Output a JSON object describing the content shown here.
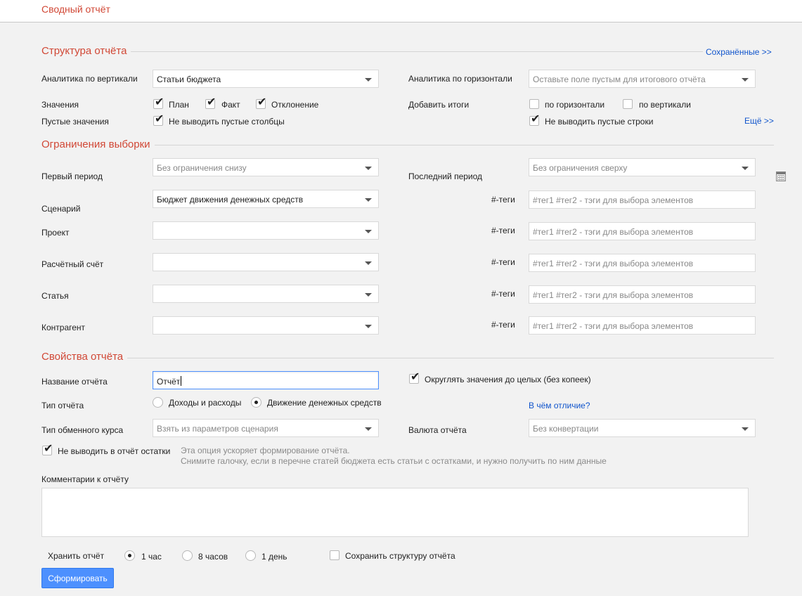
{
  "app": {
    "title": "Сводный отчёт"
  },
  "structure": {
    "title": "Структура отчёта",
    "saved_link": "Сохранённые >>",
    "more_link": "Ещё >>",
    "vertical": {
      "label": "Аналитика по вертикали",
      "value": "Статьи бюджета"
    },
    "horizontal": {
      "label": "Аналитика по горизонтали",
      "placeholder": "Оставьте поле пустым для итогового отчёта"
    },
    "values": {
      "label": "Значения",
      "plan": "План",
      "fact": "Факт",
      "deviation": "Отклонение"
    },
    "totals": {
      "label": "Добавить итоги",
      "horizontal": "по горизонтали",
      "vertical": "по вертикали"
    },
    "empty": {
      "label": "Пустые значения",
      "no_columns": "Не выводить пустые столбцы",
      "no_rows": "Не выводить пустые строки"
    }
  },
  "filters": {
    "title": "Ограничения выборки",
    "first_period": {
      "label": "Первый период",
      "placeholder": "Без ограничения снизу"
    },
    "last_period": {
      "label": "Последний период",
      "placeholder": "Без ограничения сверху"
    },
    "scenario": {
      "label": "Сценарий",
      "value": "Бюджет движения денежных средств"
    },
    "project": {
      "label": "Проект"
    },
    "account": {
      "label": "Расчётный счёт"
    },
    "article": {
      "label": "Статья"
    },
    "contractor": {
      "label": "Контрагент"
    },
    "tags_label": "#-теги",
    "tags_placeholder": "#тег1 #тег2 - тэги для выбора элементов"
  },
  "properties": {
    "title": "Свойства отчёта",
    "name": {
      "label": "Название отчёта",
      "value": "Отчёт"
    },
    "round": "Округлять значения до целых (без копеек)",
    "type": {
      "label": "Тип отчёта",
      "income_expense": "Доходы и расходы",
      "cash_flow": "Движение денежных средств",
      "difference_link": "В чём отличие?"
    },
    "rate": {
      "label": "Тип обменного курса",
      "placeholder": "Взять из параметров сценария"
    },
    "currency": {
      "label": "Валюта отчёта",
      "placeholder": "Без конвертации"
    },
    "no_balances": "Не выводить в отчёт остатки",
    "hint_line1": "Эта опция ускоряет формирование отчёта.",
    "hint_line2": "Снимите галочку, если в перечне статей бюджета есть статьи с остатками, и нужно получить по ним данные",
    "comments_label": "Комментарии к отчёту"
  },
  "storage": {
    "label": "Хранить отчёт",
    "opt_1h": "1 час",
    "opt_8h": "8 часов",
    "opt_1d": "1 день",
    "save_structure": "Сохранить структуру отчёта"
  },
  "submit": "Сформировать",
  "colors": {
    "accent": "#d14836",
    "link": "#1155cc",
    "button": "#4d90fe"
  }
}
